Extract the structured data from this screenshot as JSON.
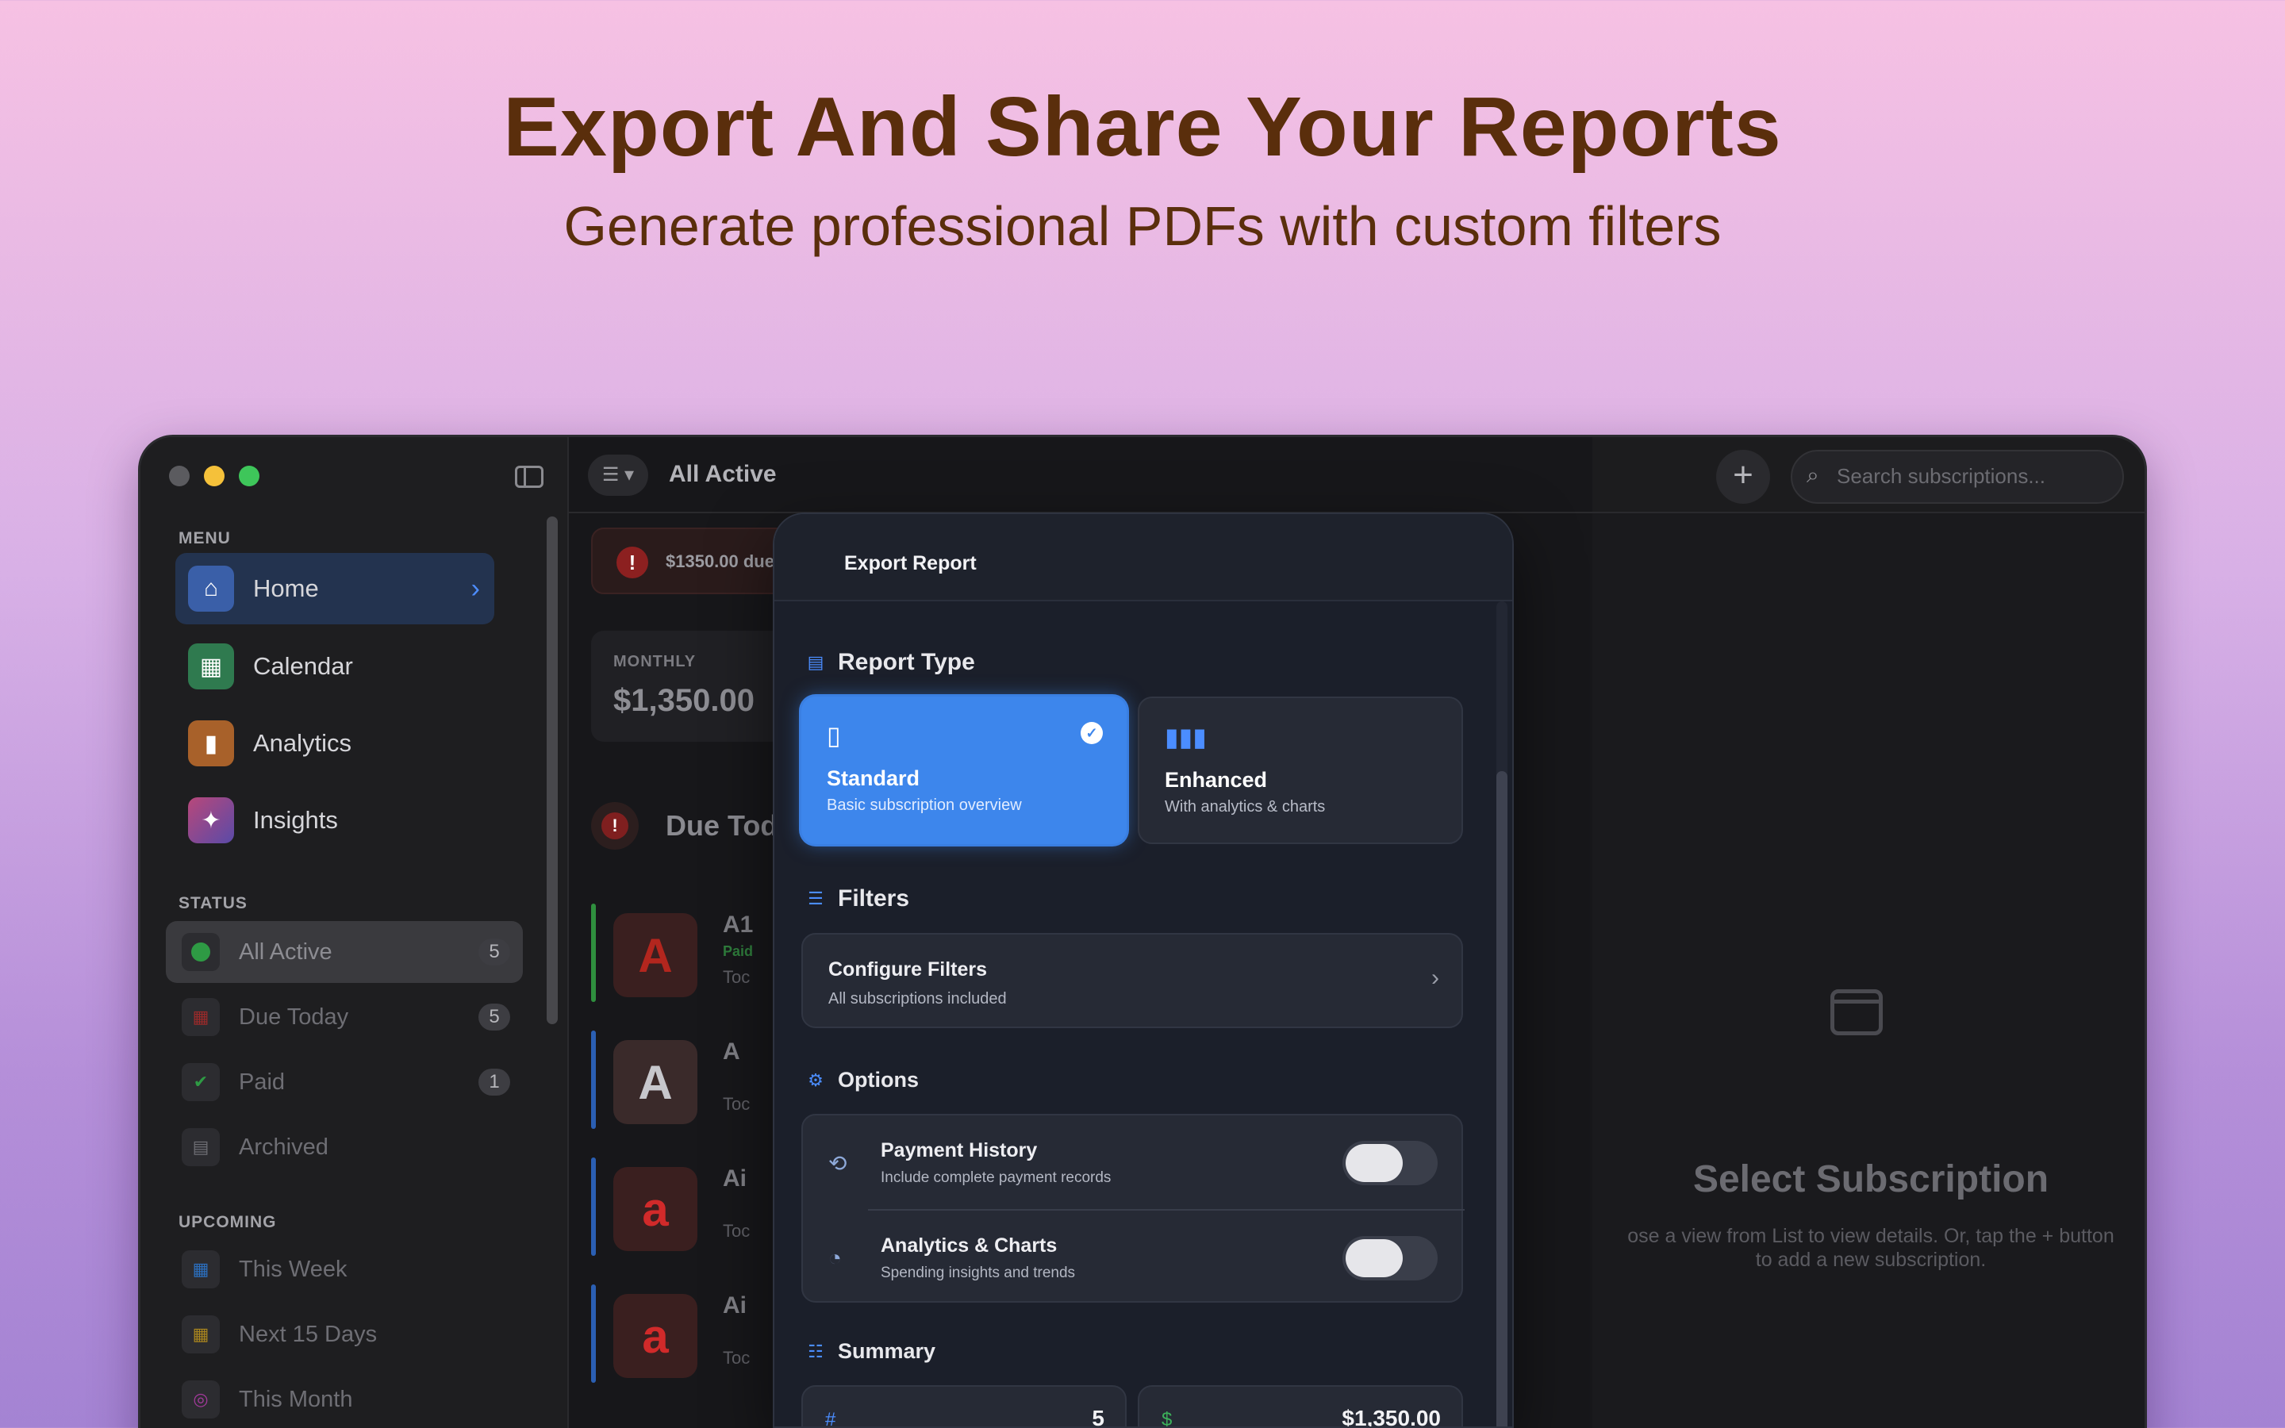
{
  "hero": {
    "title": "Export And Share Your Reports",
    "subtitle": "Generate professional PDFs with custom filters"
  },
  "colors": {
    "accent": "#3d86ec",
    "traffic_red": "#5b5b5f",
    "traffic_yellow": "#f5c13a",
    "traffic_green": "#3ec65a"
  },
  "sidebar": {
    "menu_label": "MENU",
    "menu": [
      {
        "label": "Home",
        "icon": "home-icon",
        "color": "#3a5fa8"
      },
      {
        "label": "Calendar",
        "icon": "calendar-icon",
        "color": "#2f7a4f"
      },
      {
        "label": "Analytics",
        "icon": "bar-chart-icon",
        "color": "#a8612a"
      },
      {
        "label": "Insights",
        "icon": "sparkle-icon",
        "color": "#8a3f8e"
      }
    ],
    "status_label": "STATUS",
    "status": [
      {
        "label": "All Active",
        "badge": "5",
        "icon": "active-dot-icon"
      },
      {
        "label": "Due Today",
        "badge": "5",
        "icon": "calendar-alert-icon"
      },
      {
        "label": "Paid",
        "badge": "1",
        "icon": "check-circle-icon"
      },
      {
        "label": "Archived",
        "badge": "",
        "icon": "archive-box-icon"
      }
    ],
    "upcoming_label": "UPCOMING",
    "upcoming": [
      {
        "label": "This Week",
        "icon": "calendar-week-icon"
      },
      {
        "label": "Next 15 Days",
        "icon": "calendar-clock-icon"
      },
      {
        "label": "This Month",
        "icon": "calendar-month-icon"
      }
    ]
  },
  "toolbar": {
    "title": "All Active",
    "search_placeholder": "Search subscriptions..."
  },
  "list": {
    "alert_text": "$1350.00 due",
    "monthly_label": "MONTHLY",
    "monthly_value": "$1,350.00",
    "due_title": "Due Toda",
    "rows": [
      {
        "name": "A1",
        "sub": "Toc",
        "paid": "Paid",
        "logo": "A",
        "bar": "#2f8f3e",
        "logo_color": "#b3261e"
      },
      {
        "name": "A",
        "sub": "Toc",
        "paid": "",
        "logo": "A",
        "bar": "#2b5fb3",
        "logo_color": "#c7c7cc"
      },
      {
        "name": "Ai",
        "sub": "Toc",
        "paid": "",
        "logo": "a",
        "bar": "#2b5fb3",
        "logo_color": "#d12a2a"
      },
      {
        "name": "Ai",
        "sub": "Toc",
        "paid": "",
        "logo": "a",
        "bar": "#2b5fb3",
        "logo_color": "#d12a2a"
      }
    ]
  },
  "detail": {
    "title": "Select Subscription",
    "description": "ose a view from List to view details. Or, tap the + button to add a new subscription."
  },
  "modal": {
    "title": "Export Report",
    "report_type_label": "Report Type",
    "report_types": [
      {
        "name": "Standard",
        "desc": "Basic subscription overview",
        "selected": true
      },
      {
        "name": "Enhanced",
        "desc": "With analytics & charts",
        "selected": false
      }
    ],
    "filters_label": "Filters",
    "filters_card": {
      "title": "Configure Filters",
      "sub": "All subscriptions included"
    },
    "options_label": "Options",
    "options": [
      {
        "title": "Payment History",
        "sub": "Include complete payment records",
        "icon": "history-clock-icon",
        "enabled": false
      },
      {
        "title": "Analytics & Charts",
        "sub": "Spending insights and trends",
        "icon": "pie-chart-icon",
        "enabled": false
      }
    ],
    "summary_label": "Summary",
    "summary": [
      {
        "icon": "#",
        "value": "5"
      },
      {
        "icon": "$",
        "value": "$1,350.00"
      }
    ]
  }
}
